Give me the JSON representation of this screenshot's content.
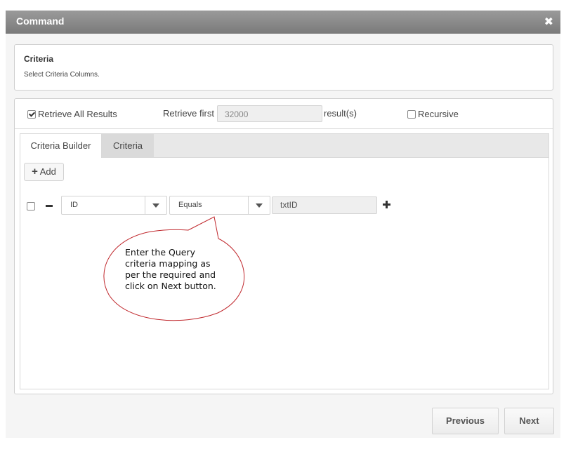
{
  "dialog": {
    "title": "Command"
  },
  "criteria_panel": {
    "heading": "Criteria",
    "subtitle": "Select Criteria Columns."
  },
  "options": {
    "retrieve_all_label": "Retrieve All Results",
    "retrieve_all_checked": true,
    "retrieve_first_label": "Retrieve first",
    "retrieve_first_value": "32000",
    "results_suffix": "result(s)",
    "recursive_label": "Recursive",
    "recursive_checked": false
  },
  "tabs": [
    {
      "label": "Criteria Builder",
      "active": true
    },
    {
      "label": "Criteria",
      "active": false
    }
  ],
  "builder": {
    "add_label": "Add",
    "rows": [
      {
        "field": "ID",
        "operator": "Equals",
        "value": "txtID",
        "checked": false
      }
    ]
  },
  "callout": {
    "text": "Enter the Query\ncriteria mapping as\nper the required and\nclick on Next button."
  },
  "footer": {
    "previous_label": "Previous",
    "next_label": "Next"
  }
}
